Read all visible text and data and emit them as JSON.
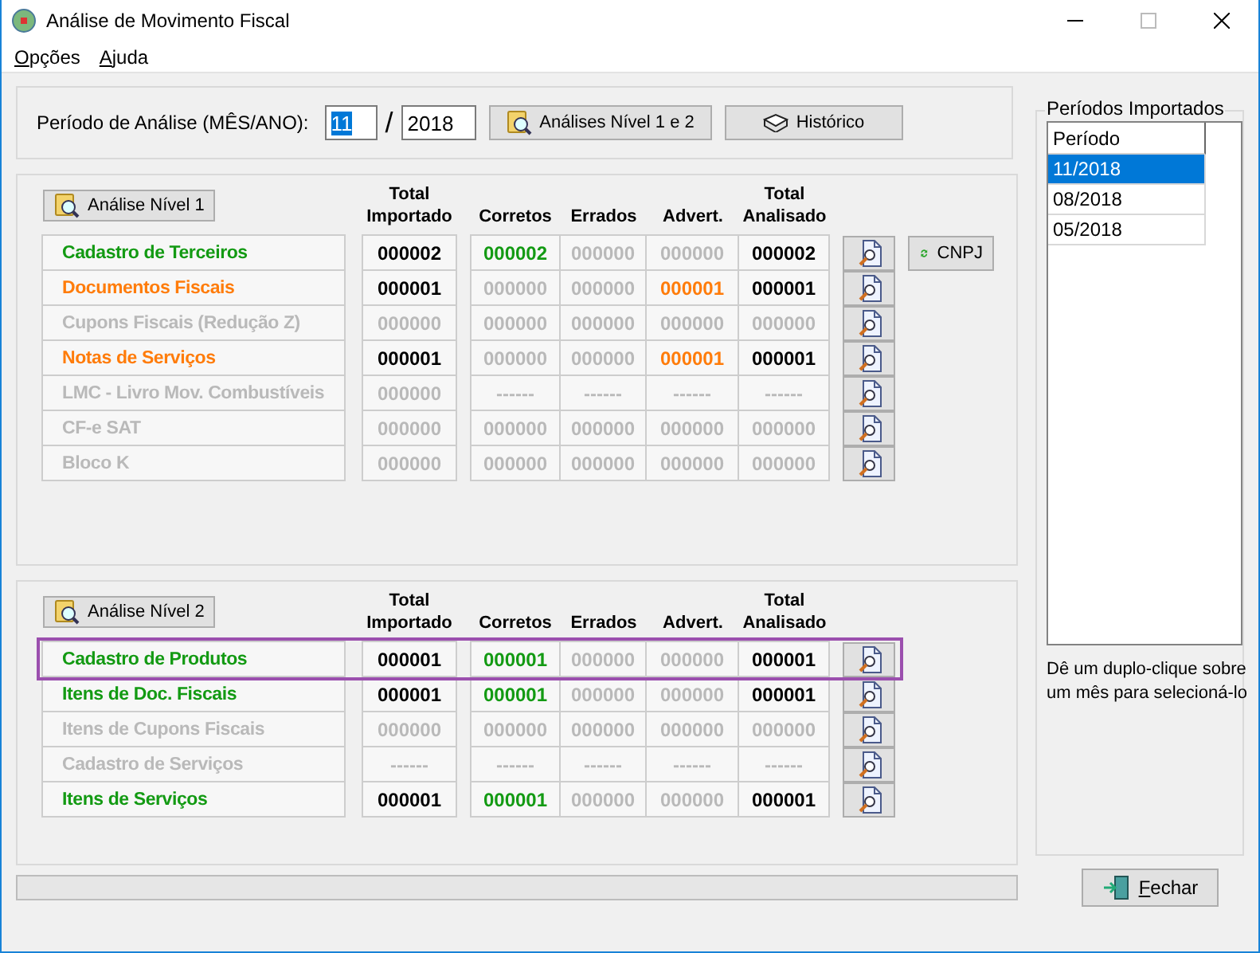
{
  "window": {
    "title": "Análise de Movimento Fiscal"
  },
  "menu": [
    {
      "label": "Opções"
    },
    {
      "label": "Ajuda"
    }
  ],
  "period": {
    "label": "Período de Análise (MÊS/ANO):",
    "month": "11",
    "month_selected": true,
    "separator": "/",
    "year": "2018"
  },
  "toolbar_buttons": [
    {
      "label": "Análises Nível 1 e 2",
      "kind": "analyze"
    },
    {
      "label": "Histórico",
      "kind": "history"
    }
  ],
  "levels": [
    {
      "button": "Análise Nível 1",
      "columns": [
        "Total\nImportado",
        "Corretos",
        "Errados",
        "Advert.",
        "Total\nAnalisado"
      ],
      "rows": [
        {
          "name": "Cadastro de Terceiros",
          "color": "#139a13",
          "highlighted": false,
          "extra_button": "CNPJ",
          "cells": [
            {
              "text": "000002",
              "color": "#000000"
            },
            {
              "text": "000002",
              "color": "#139a13"
            },
            {
              "text": "000000",
              "color": "#b9b9b9"
            },
            {
              "text": "000000",
              "color": "#b9b9b9"
            },
            {
              "text": "000002",
              "color": "#000000"
            }
          ]
        },
        {
          "name": "Documentos Fiscais",
          "color": "#ff7c0a",
          "highlighted": false,
          "cells": [
            {
              "text": "000001",
              "color": "#000000"
            },
            {
              "text": "000000",
              "color": "#b9b9b9"
            },
            {
              "text": "000000",
              "color": "#b9b9b9"
            },
            {
              "text": "000001",
              "color": "#ff7c0a"
            },
            {
              "text": "000001",
              "color": "#000000"
            }
          ]
        },
        {
          "name": "Cupons Fiscais (Redução Z)",
          "color": "#b9b9b9",
          "highlighted": false,
          "cells": [
            {
              "text": "000000",
              "color": "#b9b9b9"
            },
            {
              "text": "000000",
              "color": "#b9b9b9"
            },
            {
              "text": "000000",
              "color": "#b9b9b9"
            },
            {
              "text": "000000",
              "color": "#b9b9b9"
            },
            {
              "text": "000000",
              "color": "#b9b9b9"
            }
          ]
        },
        {
          "name": "Notas de Serviços",
          "color": "#ff7c0a",
          "highlighted": false,
          "cells": [
            {
              "text": "000001",
              "color": "#000000"
            },
            {
              "text": "000000",
              "color": "#b9b9b9"
            },
            {
              "text": "000000",
              "color": "#b9b9b9"
            },
            {
              "text": "000001",
              "color": "#ff7c0a"
            },
            {
              "text": "000001",
              "color": "#000000"
            }
          ]
        },
        {
          "name": "LMC - Livro Mov. Combustíveis",
          "color": "#b9b9b9",
          "highlighted": false,
          "cells": [
            {
              "text": "000000",
              "color": "#b9b9b9"
            },
            {
              "text": "------",
              "color": "#b9b9b9"
            },
            {
              "text": "------",
              "color": "#b9b9b9"
            },
            {
              "text": "------",
              "color": "#b9b9b9"
            },
            {
              "text": "------",
              "color": "#b9b9b9"
            }
          ]
        },
        {
          "name": "CF-e SAT",
          "color": "#b9b9b9",
          "highlighted": false,
          "cells": [
            {
              "text": "000000",
              "color": "#b9b9b9"
            },
            {
              "text": "000000",
              "color": "#b9b9b9"
            },
            {
              "text": "000000",
              "color": "#b9b9b9"
            },
            {
              "text": "000000",
              "color": "#b9b9b9"
            },
            {
              "text": "000000",
              "color": "#b9b9b9"
            }
          ]
        },
        {
          "name": "Bloco K",
          "color": "#b9b9b9",
          "highlighted": false,
          "cells": [
            {
              "text": "000000",
              "color": "#b9b9b9"
            },
            {
              "text": "000000",
              "color": "#b9b9b9"
            },
            {
              "text": "000000",
              "color": "#b9b9b9"
            },
            {
              "text": "000000",
              "color": "#b9b9b9"
            },
            {
              "text": "000000",
              "color": "#b9b9b9"
            }
          ]
        }
      ]
    },
    {
      "button": "Análise Nível 2",
      "columns": [
        "Total\nImportado",
        "Corretos",
        "Errados",
        "Advert.",
        "Total\nAnalisado"
      ],
      "rows": [
        {
          "name": "Cadastro de Produtos",
          "color": "#139a13",
          "highlighted": true,
          "cells": [
            {
              "text": "000001",
              "color": "#000000"
            },
            {
              "text": "000001",
              "color": "#139a13"
            },
            {
              "text": "000000",
              "color": "#b9b9b9"
            },
            {
              "text": "000000",
              "color": "#b9b9b9"
            },
            {
              "text": "000001",
              "color": "#000000"
            }
          ]
        },
        {
          "name": "Itens de Doc. Fiscais",
          "color": "#139a13",
          "highlighted": false,
          "cells": [
            {
              "text": "000001",
              "color": "#000000"
            },
            {
              "text": "000001",
              "color": "#139a13"
            },
            {
              "text": "000000",
              "color": "#b9b9b9"
            },
            {
              "text": "000000",
              "color": "#b9b9b9"
            },
            {
              "text": "000001",
              "color": "#000000"
            }
          ]
        },
        {
          "name": "Itens de Cupons Fiscais",
          "color": "#b9b9b9",
          "highlighted": false,
          "cells": [
            {
              "text": "000000",
              "color": "#b9b9b9"
            },
            {
              "text": "000000",
              "color": "#b9b9b9"
            },
            {
              "text": "000000",
              "color": "#b9b9b9"
            },
            {
              "text": "000000",
              "color": "#b9b9b9"
            },
            {
              "text": "000000",
              "color": "#b9b9b9"
            }
          ]
        },
        {
          "name": "Cadastro de Serviços",
          "color": "#b9b9b9",
          "highlighted": false,
          "cells": [
            {
              "text": "------",
              "color": "#b9b9b9"
            },
            {
              "text": "------",
              "color": "#b9b9b9"
            },
            {
              "text": "------",
              "color": "#b9b9b9"
            },
            {
              "text": "------",
              "color": "#b9b9b9"
            },
            {
              "text": "------",
              "color": "#b9b9b9"
            }
          ]
        },
        {
          "name": "Itens de Serviços",
          "color": "#139a13",
          "highlighted": false,
          "cells": [
            {
              "text": "000001",
              "color": "#000000"
            },
            {
              "text": "000001",
              "color": "#139a13"
            },
            {
              "text": "000000",
              "color": "#b9b9b9"
            },
            {
              "text": "000000",
              "color": "#b9b9b9"
            },
            {
              "text": "000001",
              "color": "#000000"
            }
          ]
        }
      ]
    }
  ],
  "imported_periods": {
    "title": "Períodos Importados",
    "column": "Período",
    "rows": [
      {
        "text": "11/2018",
        "selected": true
      },
      {
        "text": "08/2018",
        "selected": false
      },
      {
        "text": "05/2018",
        "selected": false
      }
    ],
    "hint": "Dê um duplo-clique sobre um mês para selecioná-lo"
  },
  "close_button": "Fechar"
}
